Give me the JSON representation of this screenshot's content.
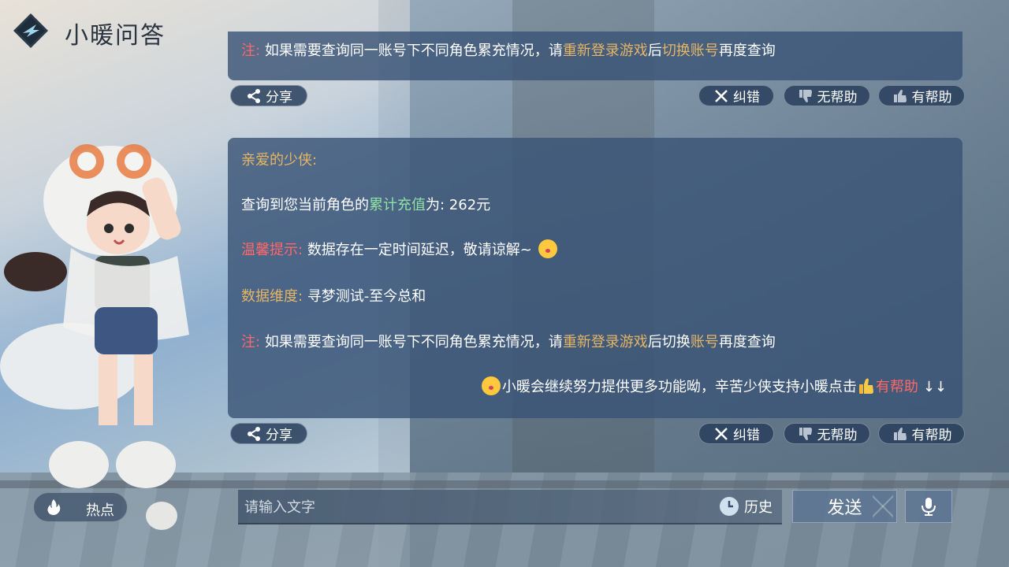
{
  "header": {
    "title": "小暖问答",
    "logo_icon": "diamond-logo-icon"
  },
  "card1": {
    "note_prefix": "注:",
    "note_a": "如果需要查询同一账号下不同角色累充情况，请",
    "note_b_gold": "重新登录游戏",
    "note_c": "后",
    "note_d_gold": "切换账号",
    "note_e": "再度查询"
  },
  "card2": {
    "greeting": "亲爱的少侠:",
    "query_a": "查询到您当前角色的",
    "query_b_green": "累计充值",
    "query_c": "为: 262元",
    "tip_label": "温馨提示:",
    "tip_text": "数据存在一定时间延迟，敬请谅解~",
    "dimension_label": "数据维度:",
    "dimension_value": "寻梦测试-至今总和",
    "note_prefix": "注:",
    "note_a": "如果需要查询同一账号下不同角色累充情况，请",
    "note_b_gold": "重新登录游戏",
    "note_c": "后切换",
    "note_d_gold": "账号",
    "note_e": "再度查询",
    "footer_text": "小暖会继续努力提供更多功能呦，辛苦少侠支持小暖点击",
    "footer_red": "有帮助",
    "footer_arrows": "↓↓"
  },
  "actions": {
    "share": "分享",
    "correct": "纠错",
    "not_helpful": "无帮助",
    "helpful": "有帮助"
  },
  "bottom": {
    "hot_label": "热点",
    "input_placeholder": "请输入文字",
    "history_label": "历史",
    "send_label": "发送"
  },
  "colors": {
    "accent_gold": "#e5b566",
    "accent_red": "#ff6868",
    "accent_green": "#8fe0a4",
    "card_bg": "#3a5476"
  }
}
